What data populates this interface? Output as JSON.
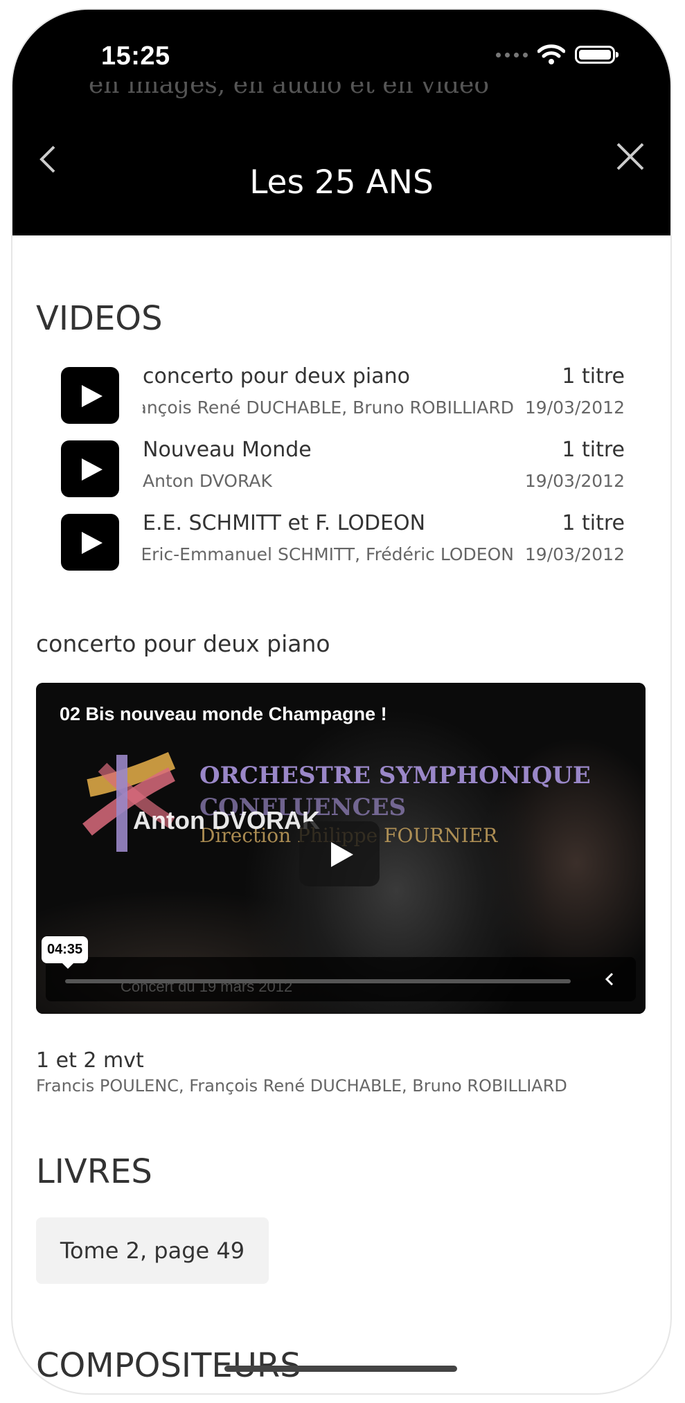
{
  "status_bar": {
    "time": "15:25"
  },
  "header": {
    "title": "Les 25 ANS",
    "ghost_text": "en images, en audio et en vidéo"
  },
  "videos_section": {
    "heading": "VIDEOS",
    "items": [
      {
        "title": "concerto pour deux piano",
        "artists": "François René DUCHABLE, Bruno ROBILLIARD",
        "count": "1 titre",
        "date": "19/03/2012"
      },
      {
        "title": "Nouveau Monde",
        "artists": "Anton DVORAK",
        "count": "1 titre",
        "date": "19/03/2012"
      },
      {
        "title": "E.E. SCHMITT et F. LODEON",
        "artists": "Eric-Emmanuel SCHMITT, Frédéric LODEON",
        "count": "1 titre",
        "date": "19/03/2012"
      }
    ]
  },
  "selected_album": {
    "title": "concerto pour deux piano"
  },
  "player": {
    "video_title": "02 Bis nouveau monde Champagne !",
    "overlay_line1": "ORCHESTRE SYMPHONIQUE",
    "overlay_line2": "CONFLUENCES",
    "overlay_line3": "Direction Philippe FOURNIER",
    "overlay_name": "Anton DVORAK",
    "caption": "Concert du 19 mars 2012",
    "duration": "04:35",
    "progress": 0.0
  },
  "current_video": {
    "name": "1 et 2  mvt",
    "artists": "Francis POULENC, François René DUCHABLE, Bruno ROBILLIARD"
  },
  "books_section": {
    "heading": "LIVRES",
    "items": [
      {
        "label": "Tome 2, page 49"
      }
    ]
  },
  "composers_section": {
    "heading": "COMPOSITEURS"
  },
  "icons": {
    "back": "chevron-left-icon",
    "close": "close-icon",
    "play": "play-icon",
    "collapse": "chevron-left-icon"
  }
}
